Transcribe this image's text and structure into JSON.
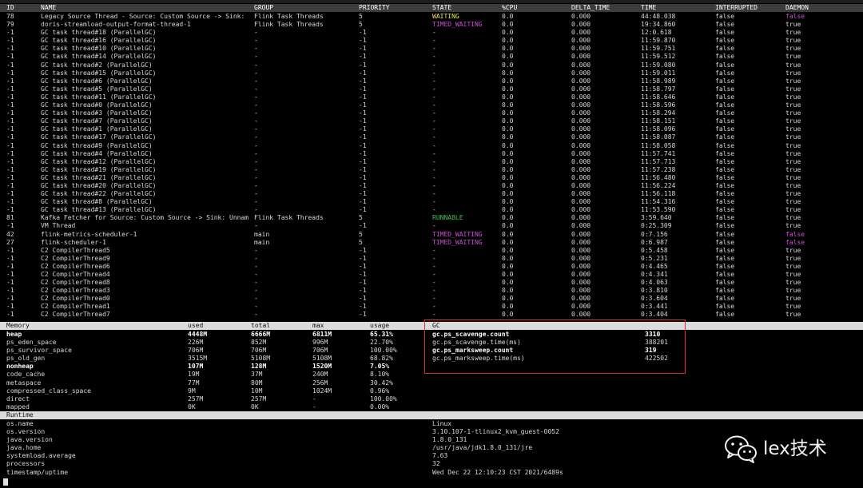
{
  "threads": {
    "columns": [
      "ID",
      "NAME",
      "GROUP",
      "PRIORITY",
      "STATE",
      "%CPU",
      "DELTA_TIME",
      "TIME",
      "INTERRUPTED",
      "DAEMON"
    ],
    "rows": [
      [
        "78",
        "Legacy Source Thread - Source: Custom Source -> Sink:",
        "Flink Task Threads",
        "5",
        "WAITING",
        "0.0",
        "0.000",
        "44:48.038",
        "false",
        "false"
      ],
      [
        "79",
        "doris-streamload-output-format-thread-1",
        "Flink Task Threads",
        "5",
        "TIMED_WAITING",
        "0.0",
        "0.000",
        "19:34.860",
        "false",
        "true"
      ],
      [
        "-1",
        "GC task thread#18 (ParallelGC)",
        "-",
        "-1",
        "-",
        "0.0",
        "0.000",
        "12:0.618",
        "false",
        "true"
      ],
      [
        "-1",
        "GC task thread#16 (ParallelGC)",
        "-",
        "-1",
        "-",
        "0.0",
        "0.000",
        "11:59.870",
        "false",
        "true"
      ],
      [
        "-1",
        "GC task thread#10 (ParallelGC)",
        "-",
        "-1",
        "-",
        "0.0",
        "0.000",
        "11:59.751",
        "false",
        "true"
      ],
      [
        "-1",
        "GC task thread#14 (ParallelGC)",
        "-",
        "-1",
        "-",
        "0.0",
        "0.000",
        "11:59.512",
        "false",
        "true"
      ],
      [
        "-1",
        "GC task thread#2 (ParallelGC)",
        "-",
        "-1",
        "-",
        "0.0",
        "0.000",
        "11:59.080",
        "false",
        "true"
      ],
      [
        "-1",
        "GC task thread#15 (ParallelGC)",
        "-",
        "-1",
        "-",
        "0.0",
        "0.000",
        "11:59.011",
        "false",
        "true"
      ],
      [
        "-1",
        "GC task thread#6 (ParallelGC)",
        "-",
        "-1",
        "-",
        "0.0",
        "0.000",
        "11:58.989",
        "false",
        "true"
      ],
      [
        "-1",
        "GC task thread#5 (ParallelGC)",
        "-",
        "-1",
        "-",
        "0.0",
        "0.000",
        "11:58.797",
        "false",
        "true"
      ],
      [
        "-1",
        "GC task thread#11 (ParallelGC)",
        "-",
        "-1",
        "-",
        "0.0",
        "0.000",
        "11:58.646",
        "false",
        "true"
      ],
      [
        "-1",
        "GC task thread#0 (ParallelGC)",
        "-",
        "-1",
        "-",
        "0.0",
        "0.000",
        "11:58.596",
        "false",
        "true"
      ],
      [
        "-1",
        "GC task thread#3 (ParallelGC)",
        "-",
        "-1",
        "-",
        "0.0",
        "0.000",
        "11:58.294",
        "false",
        "true"
      ],
      [
        "-1",
        "GC task thread#7 (ParallelGC)",
        "-",
        "-1",
        "-",
        "0.0",
        "0.000",
        "11:58.151",
        "false",
        "true"
      ],
      [
        "-1",
        "GC task thread#1 (ParallelGC)",
        "-",
        "-1",
        "-",
        "0.0",
        "0.000",
        "11:58.096",
        "false",
        "true"
      ],
      [
        "-1",
        "GC task thread#17 (ParallelGC)",
        "-",
        "-1",
        "-",
        "0.0",
        "0.000",
        "11:58.087",
        "false",
        "true"
      ],
      [
        "-1",
        "GC task thread#9 (ParallelGC)",
        "-",
        "-1",
        "-",
        "0.0",
        "0.000",
        "11:58.058",
        "false",
        "true"
      ],
      [
        "-1",
        "GC task thread#4 (ParallelGC)",
        "-",
        "-1",
        "-",
        "0.0",
        "0.000",
        "11:57.741",
        "false",
        "true"
      ],
      [
        "-1",
        "GC task thread#12 (ParallelGC)",
        "-",
        "-1",
        "-",
        "0.0",
        "0.000",
        "11:57.713",
        "false",
        "true"
      ],
      [
        "-1",
        "GC task thread#19 (ParallelGC)",
        "-",
        "-1",
        "-",
        "0.0",
        "0.000",
        "11:57.238",
        "false",
        "true"
      ],
      [
        "-1",
        "GC task thread#21 (ParallelGC)",
        "-",
        "-1",
        "-",
        "0.0",
        "0.000",
        "11:56.480",
        "false",
        "true"
      ],
      [
        "-1",
        "GC task thread#20 (ParallelGC)",
        "-",
        "-1",
        "-",
        "0.0",
        "0.000",
        "11:56.224",
        "false",
        "true"
      ],
      [
        "-1",
        "GC task thread#22 (ParallelGC)",
        "-",
        "-1",
        "-",
        "0.0",
        "0.000",
        "11:56.118",
        "false",
        "true"
      ],
      [
        "-1",
        "GC task thread#8 (ParallelGC)",
        "-",
        "-1",
        "-",
        "0.0",
        "0.000",
        "11:54.316",
        "false",
        "true"
      ],
      [
        "-1",
        "GC task thread#13 (ParallelGC)",
        "-",
        "-1",
        "-",
        "0.0",
        "0.000",
        "11:53.590",
        "false",
        "true"
      ],
      [
        "81",
        "Kafka Fetcher for Source: Custom Source -> Sink: Unnam",
        "Flink Task Threads",
        "5",
        "RUNNABLE",
        "0.0",
        "0.000",
        "3:59.640",
        "false",
        "true"
      ],
      [
        "-1",
        "VM Thread",
        "-",
        "-1",
        "-",
        "0.0",
        "0.000",
        "0:25.309",
        "false",
        "true"
      ],
      [
        "42",
        "flink-metrics-scheduler-1",
        "main",
        "5",
        "TIMED_WAITING",
        "0.0",
        "0.000",
        "0:7.156",
        "false",
        "false"
      ],
      [
        "27",
        "flink-scheduler-1",
        "main",
        "5",
        "TIMED_WAITING",
        "0.0",
        "0.000",
        "0:6.987",
        "false",
        "false"
      ],
      [
        "-1",
        "C2 CompilerThread5",
        "-",
        "-1",
        "-",
        "0.0",
        "0.000",
        "0:5.458",
        "false",
        "true"
      ],
      [
        "-1",
        "C2 CompilerThread9",
        "-",
        "-1",
        "-",
        "0.0",
        "0.000",
        "0:5.231",
        "false",
        "true"
      ],
      [
        "-1",
        "C2 CompilerThread6",
        "-",
        "-1",
        "-",
        "0.0",
        "0.000",
        "0:4.465",
        "false",
        "true"
      ],
      [
        "-1",
        "C2 CompilerThread4",
        "-",
        "-1",
        "-",
        "0.0",
        "0.000",
        "0:4.341",
        "false",
        "true"
      ],
      [
        "-1",
        "C2 CompilerThread8",
        "-",
        "-1",
        "-",
        "0.0",
        "0.000",
        "0:4.063",
        "false",
        "true"
      ],
      [
        "-1",
        "C2 CompilerThread3",
        "-",
        "-1",
        "-",
        "0.0",
        "0.000",
        "0:3.810",
        "false",
        "true"
      ],
      [
        "-1",
        "C2 CompilerThread0",
        "-",
        "-1",
        "-",
        "0.0",
        "0.000",
        "0:3.604",
        "false",
        "true"
      ],
      [
        "-1",
        "C2 CompilerThread1",
        "-",
        "-1",
        "-",
        "0.0",
        "0.000",
        "0:3.441",
        "false",
        "true"
      ],
      [
        "-1",
        "C2 CompilerThread7",
        "-",
        "-1",
        "-",
        "0.0",
        "0.000",
        "0:3.404",
        "false",
        "true"
      ]
    ]
  },
  "memory": {
    "header": [
      "Memory",
      "used",
      "total",
      "max",
      "usage"
    ],
    "rows": [
      {
        "name": "heap",
        "used": "4448M",
        "total": "6666M",
        "max": "6811M",
        "usage": "65.31%",
        "bold": true
      },
      {
        "name": "ps_eden_space",
        "used": "226M",
        "total": "852M",
        "max": "996M",
        "usage": "22.70%"
      },
      {
        "name": "ps_survivor_space",
        "used": "706M",
        "total": "706M",
        "max": "706M",
        "usage": "100.00%"
      },
      {
        "name": "ps_old_gen",
        "used": "3515M",
        "total": "5108M",
        "max": "5108M",
        "usage": "68.82%"
      },
      {
        "name": "nonheap",
        "used": "107M",
        "total": "128M",
        "max": "1520M",
        "usage": "7.05%",
        "bold": true
      },
      {
        "name": "code_cache",
        "used": "19M",
        "total": "37M",
        "max": "240M",
        "usage": "8.10%"
      },
      {
        "name": "metaspace",
        "used": "77M",
        "total": "80M",
        "max": "256M",
        "usage": "30.42%"
      },
      {
        "name": "compressed_class_space",
        "used": "9M",
        "total": "10M",
        "max": "1024M",
        "usage": "0.96%"
      },
      {
        "name": "direct",
        "used": "257M",
        "total": "257M",
        "max": "-",
        "usage": "100.00%"
      },
      {
        "name": "mapped",
        "used": "0K",
        "total": "0K",
        "max": "-",
        "usage": "0.00%"
      }
    ]
  },
  "gc": {
    "header": "GC",
    "rows": [
      {
        "name": "gc.ps_scavenge.count",
        "value": "3310",
        "bold": true
      },
      {
        "name": "gc.ps_scavenge.time(ms)",
        "value": "388201"
      },
      {
        "name": "gc.ps_marksweep.count",
        "value": "319",
        "bold": true
      },
      {
        "name": "gc.ps_marksweep.time(ms)",
        "value": "422502"
      }
    ]
  },
  "runtime": {
    "header": "Runtime",
    "rows": [
      {
        "name": "os.name",
        "value": "Linux"
      },
      {
        "name": "os.version",
        "value": "3.10.107-1-tlinux2_kvm_guest-0052"
      },
      {
        "name": "java.version",
        "value": "1.8.0_131"
      },
      {
        "name": "java.home",
        "value": "/usr/java/jdk1.8.0_131/jre"
      },
      {
        "name": "systemload.average",
        "value": "7.63"
      },
      {
        "name": "processors",
        "value": "32"
      },
      {
        "name": "timestamp/uptime",
        "value": "Wed Dec 22 12:10:23 CST 2021/6489s"
      }
    ]
  },
  "watermark": {
    "text": "lex技术",
    "icon": "wechat-icon"
  },
  "colors": {
    "waiting": "#e8e84a",
    "timed_waiting": "#c94fd4",
    "runnable": "#3fc03f",
    "daemon_false": "#c94fd4",
    "highlight_box": "#d9302c"
  }
}
